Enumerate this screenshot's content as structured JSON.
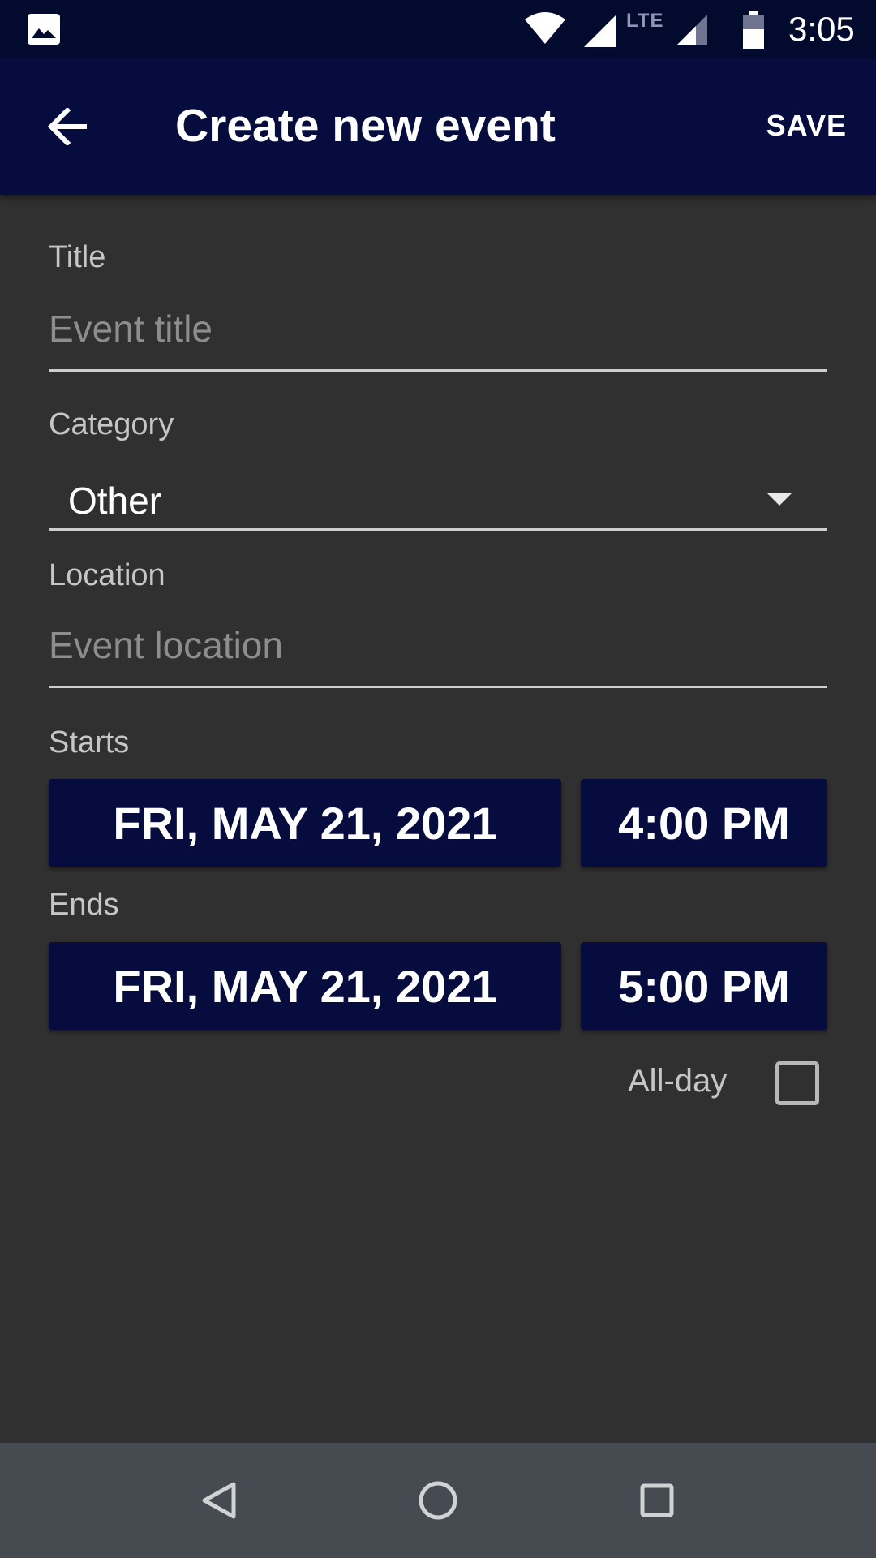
{
  "status_bar": {
    "time": "3:05",
    "network_type": "LTE",
    "icons": [
      "image-icon",
      "wifi-icon",
      "signal-icon",
      "signal-icon",
      "battery-icon"
    ]
  },
  "app_bar": {
    "title": "Create new event",
    "save_label": "SAVE",
    "back_icon": "arrow-back-icon"
  },
  "form": {
    "title": {
      "label": "Title",
      "value": "",
      "placeholder": "Event title"
    },
    "category": {
      "label": "Category",
      "selected": "Other"
    },
    "location": {
      "label": "Location",
      "value": "",
      "placeholder": "Event location"
    },
    "starts": {
      "label": "Starts",
      "date": "FRI, MAY 21, 2021",
      "time": "4:00 PM"
    },
    "ends": {
      "label": "Ends",
      "date": "FRI, MAY 21, 2021",
      "time": "5:00 PM"
    },
    "all_day": {
      "label": "All-day",
      "checked": false
    }
  },
  "nav_bar": {
    "icons": [
      "back-triangle-icon",
      "home-circle-icon",
      "recents-square-icon"
    ]
  },
  "colors": {
    "primary": "#060d3e",
    "status_bar": "#020a2e",
    "background": "#303030",
    "nav_bar": "#454b51"
  }
}
